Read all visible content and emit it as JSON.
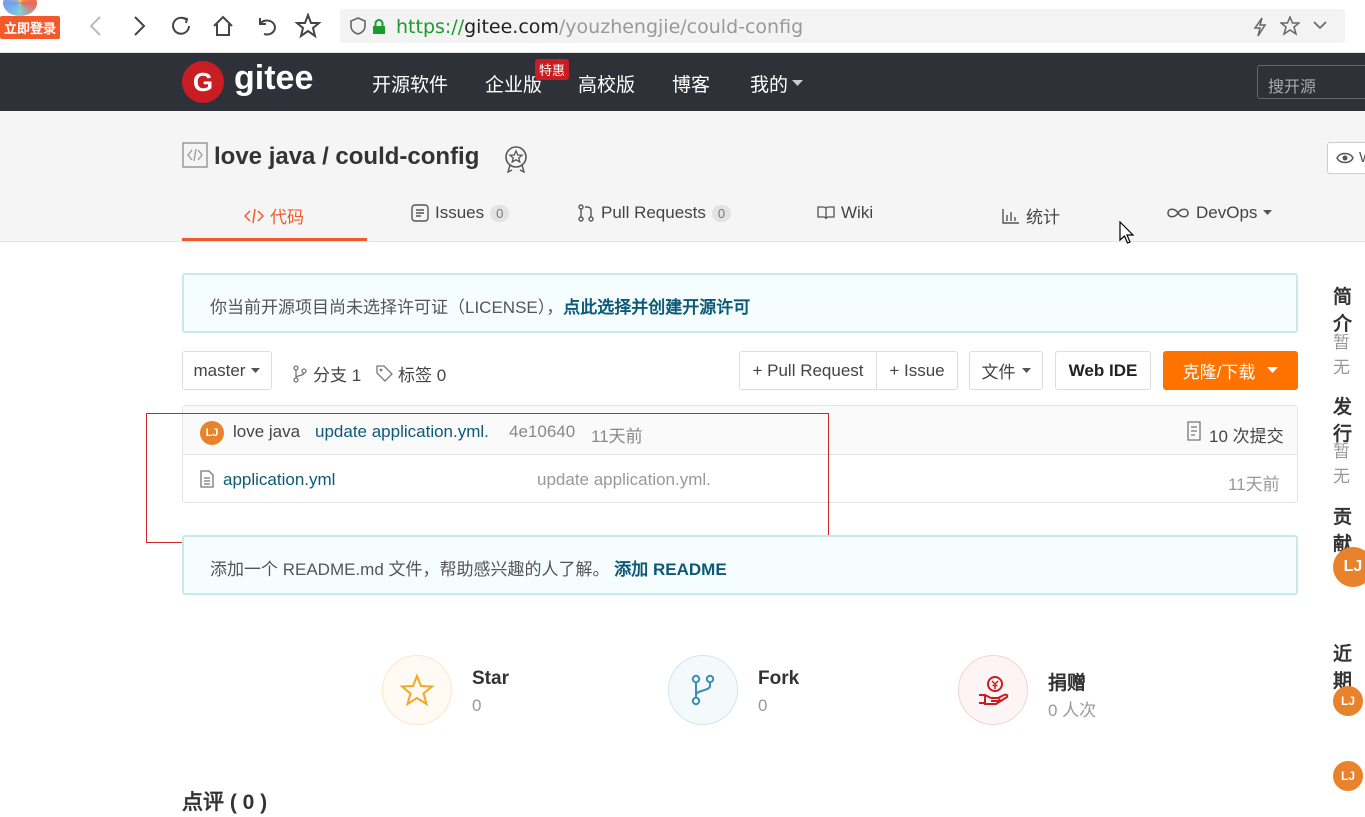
{
  "browser": {
    "login_badge": "立即登录",
    "url_proto": "https://",
    "url_host": "gitee.com",
    "url_path": "/youzhengjie/could-config"
  },
  "topnav": {
    "logo_letter": "G",
    "logo_text": "gitee",
    "items": [
      "开源软件",
      "企业版",
      "高校版",
      "博客",
      "我的"
    ],
    "promo_tag": "特惠",
    "search_placeholder": "搜开源"
  },
  "repo": {
    "title": "love java / could-config",
    "watch_label": "W",
    "tabs": {
      "code": "代码",
      "issues": "Issues",
      "issues_count": "0",
      "pulls": "Pull Requests",
      "pulls_count": "0",
      "wiki": "Wiki",
      "stats": "统计",
      "devops": "DevOps"
    }
  },
  "license_notice": {
    "text": "你当前开源项目尚未选择许可证（LICENSE），",
    "link": "点此选择并创建开源许可"
  },
  "toolbar": {
    "branch": "master",
    "branches": "分支 1",
    "tags": "标签 0",
    "pull_request": "+ Pull Request",
    "issue": "+ Issue",
    "files": "文件",
    "web_ide": "Web IDE",
    "clone": "克隆/下载"
  },
  "commit": {
    "avatar": "LJ",
    "author": "love java",
    "message": "update application.yml.",
    "hash": "4e10640",
    "time": "11天前",
    "count": "10 次提交"
  },
  "files": [
    {
      "name": "application.yml",
      "message": "update application.yml.",
      "time": "11天前"
    }
  ],
  "readme_notice": {
    "text": "添加一个 README.md 文件，帮助感兴趣的人了解。",
    "link": "添加 README"
  },
  "stats": {
    "star_label": "Star",
    "star_value": "0",
    "fork_label": "Fork",
    "fork_value": "0",
    "donate_label": "捐赠",
    "donate_value": "0 人次"
  },
  "reviews": "点评 ( 0 )",
  "sidebar": {
    "intro": "简介",
    "intro_text": "暂无",
    "release": "发行",
    "release_text": "暂无",
    "contrib": "贡献",
    "recent": "近期",
    "avatar": "LJ"
  },
  "colors": {
    "accent": "#f35a2b",
    "nav_bg": "#2e3238",
    "clone_btn": "#fe7300",
    "link": "#0c5a77"
  }
}
